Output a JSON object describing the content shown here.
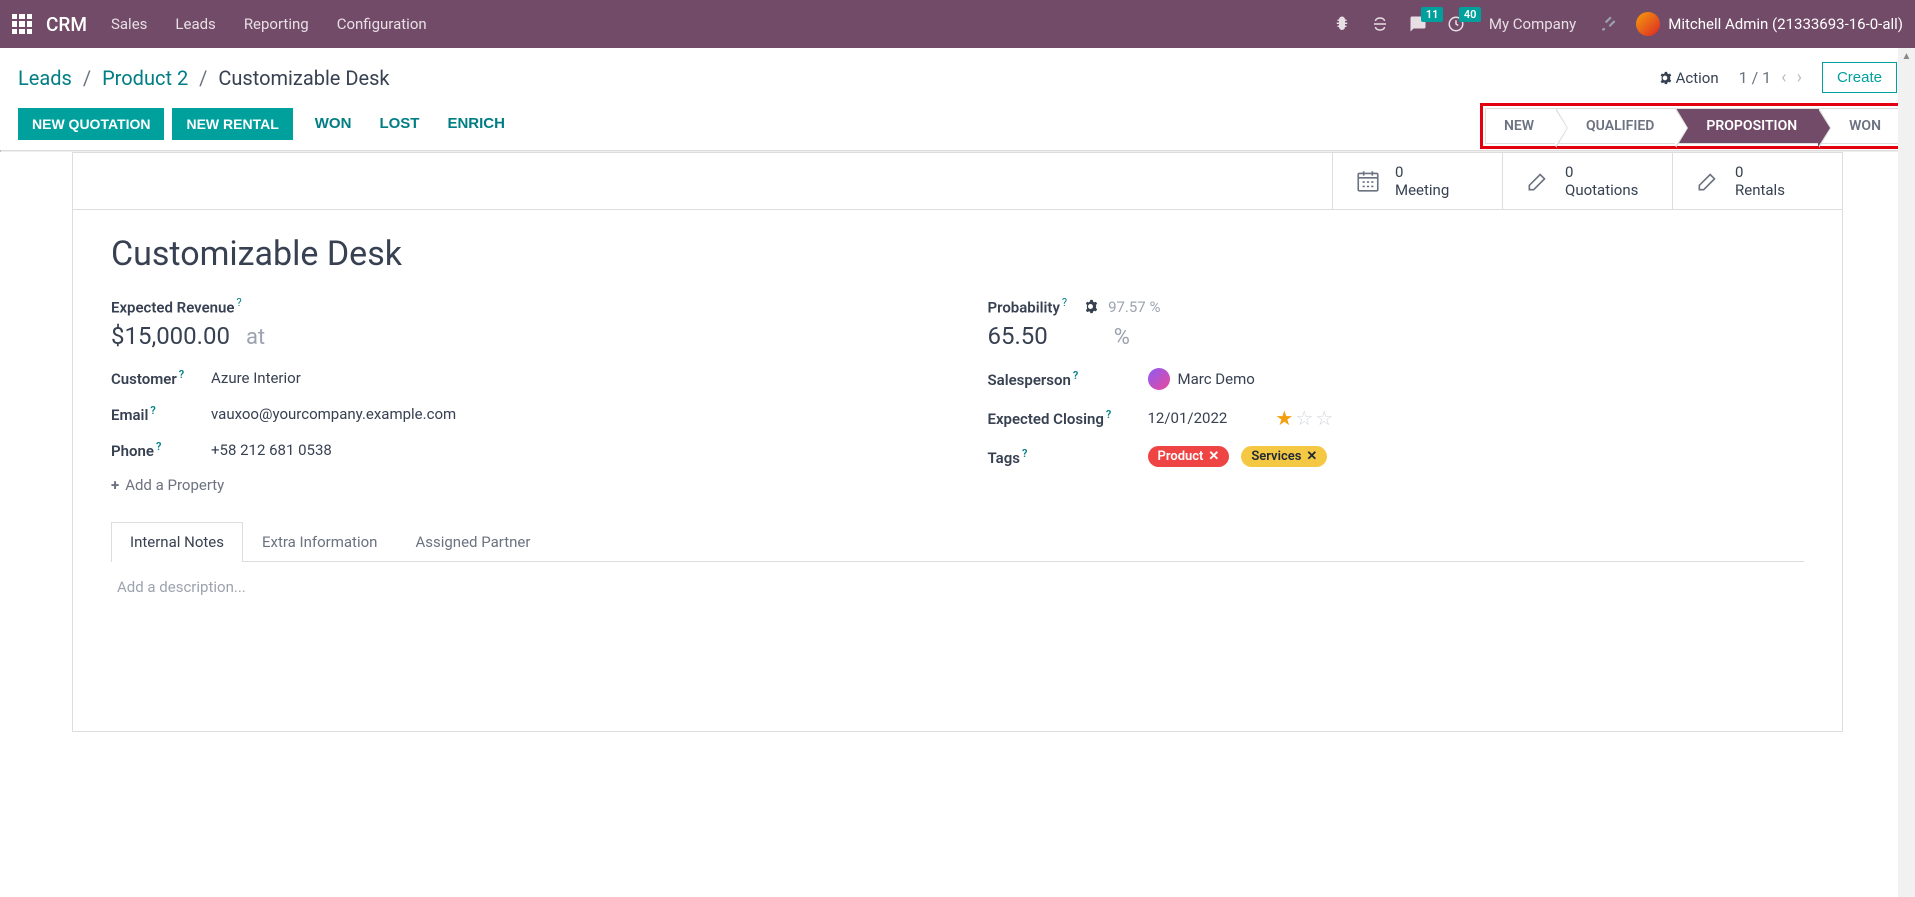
{
  "topnav": {
    "brand": "CRM",
    "menu": [
      "Sales",
      "Leads",
      "Reporting",
      "Configuration"
    ],
    "msg_badge": "11",
    "activity_badge": "40",
    "company": "My Company",
    "user": "Mitchell Admin (21333693-16-0-all)"
  },
  "breadcrumb": {
    "root": "Leads",
    "parent": "Product 2",
    "current": "Customizable Desk"
  },
  "controls": {
    "action": "Action",
    "pager": "1 / 1",
    "create": "Create"
  },
  "actions": {
    "new_quotation": "NEW QUOTATION",
    "new_rental": "NEW RENTAL",
    "won": "WON",
    "lost": "LOST",
    "enrich": "ENRICH"
  },
  "stages": [
    "NEW",
    "QUALIFIED",
    "PROPOSITION",
    "WON"
  ],
  "active_stage": "PROPOSITION",
  "statbuttons": {
    "meeting": {
      "count": "0",
      "label": "Meeting"
    },
    "quotations": {
      "count": "0",
      "label": "Quotations"
    },
    "rentals": {
      "count": "0",
      "label": "Rentals"
    }
  },
  "record": {
    "title": "Customizable Desk",
    "expected_revenue_label": "Expected Revenue",
    "expected_revenue": "$15,000.00",
    "at": "at",
    "probability_label": "Probability",
    "auto_prob": "97.57 %",
    "probability": "65.50",
    "pct_sym": "%",
    "customer_label": "Customer",
    "customer": "Azure Interior",
    "email_label": "Email",
    "email": "vauxoo@yourcompany.example.com",
    "phone_label": "Phone",
    "phone": "+58 212 681 0538",
    "salesperson_label": "Salesperson",
    "salesperson": "Marc Demo",
    "closing_label": "Expected Closing",
    "closing": "12/01/2022",
    "tags_label": "Tags",
    "tags": [
      {
        "name": "Product",
        "color": "red"
      },
      {
        "name": "Services",
        "color": "yellow"
      }
    ],
    "priority": 1,
    "add_property": "Add a Property"
  },
  "tabs": [
    "Internal Notes",
    "Extra Information",
    "Assigned Partner"
  ],
  "active_tab": "Internal Notes",
  "description_placeholder": "Add a description..."
}
